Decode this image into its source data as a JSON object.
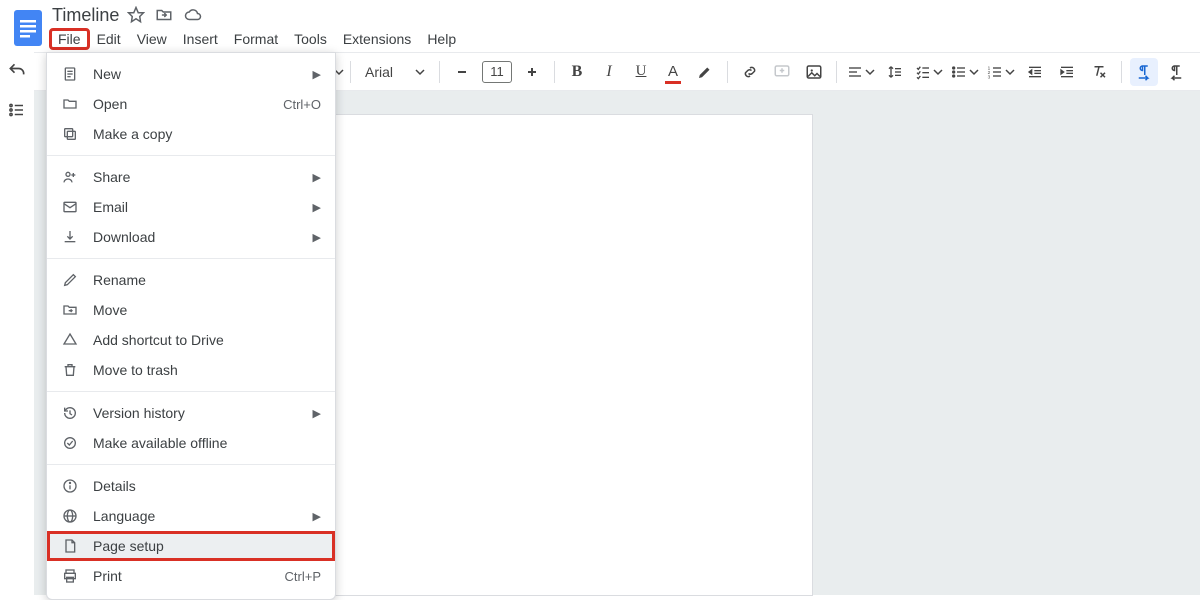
{
  "doc": {
    "title": "Timeline"
  },
  "menus": {
    "file": "File",
    "edit": "Edit",
    "view": "View",
    "insert": "Insert",
    "format": "Format",
    "tools": "Tools",
    "extensions": "Extensions",
    "help": "Help"
  },
  "toolbar": {
    "font_name": "Arial",
    "font_size": "11"
  },
  "file_menu": {
    "new": "New",
    "open": "Open",
    "open_key": "Ctrl+O",
    "make_copy": "Make a copy",
    "share": "Share",
    "email": "Email",
    "download": "Download",
    "rename": "Rename",
    "move": "Move",
    "shortcut": "Add shortcut to Drive",
    "trash": "Move to trash",
    "version": "Version history",
    "offline": "Make available offline",
    "details": "Details",
    "language": "Language",
    "page_setup": "Page setup",
    "print": "Print",
    "print_key": "Ctrl+P"
  }
}
